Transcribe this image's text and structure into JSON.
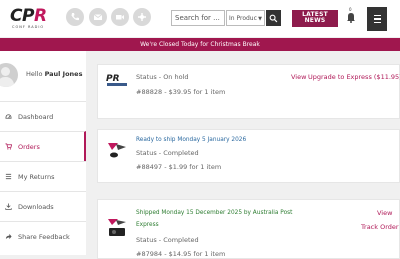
{
  "header": {
    "logo_main": "CP",
    "logo_r": "R",
    "logo_sub": "CONF RADIO",
    "search_placeholder": "Search for ...",
    "product_select": "In Produc",
    "latest_news_line1": "LATEST",
    "latest_news_line2": "NEWS",
    "notification_count": "0"
  },
  "banner": {
    "text": "We're Closed Today for Christmas Break"
  },
  "sidebar": {
    "hello": "Hello",
    "user_name": "Paul Jones",
    "items": [
      {
        "label": "Dashboard",
        "icon": "dashboard-icon"
      },
      {
        "label": "Orders",
        "icon": "cart-icon",
        "active": true
      },
      {
        "label": "My Returns",
        "icon": "list-icon"
      },
      {
        "label": "Downloads",
        "icon": "download-icon"
      },
      {
        "label": "Share Feedback",
        "icon": "share-icon"
      }
    ]
  },
  "orders": [
    {
      "status": "Status - On hold",
      "number_price": "#88828 - $39.95 for 1 item",
      "view_link": "View",
      "upgrade_link": "Upgrade to Express ($11.95)"
    },
    {
      "ship_note": "Ready to ship Monday 5 January 2026",
      "status": "Status - Completed",
      "number_price": "#88497 - $1.99 for 1 item"
    },
    {
      "ship_note_line1": "Shipped Monday 15 December 2025 by Australia Post",
      "ship_note_line2": "Express",
      "status": "Status - Completed",
      "number_price": "#87984 - $14.95 for 1 item",
      "view_link": "View",
      "track_link": "Track Order"
    }
  ],
  "colors": {
    "brand": "#a0174e",
    "accent": "#b01958"
  }
}
